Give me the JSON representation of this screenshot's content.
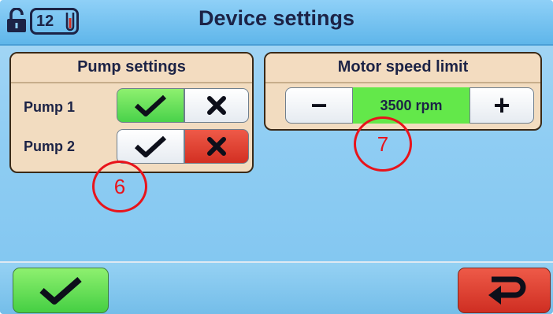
{
  "header": {
    "title": "Device settings",
    "user_level": "12",
    "lock_icon": "unlocked-padlock-icon",
    "tube_icon": "test-tube-icon"
  },
  "pump_settings": {
    "title": "Pump settings",
    "pumps": [
      {
        "label": "Pump 1",
        "enabled": true
      },
      {
        "label": "Pump 2",
        "enabled": false
      }
    ]
  },
  "motor_speed": {
    "title": "Motor speed limit",
    "value": "3500 rpm",
    "decrease_label": "−",
    "increase_label": "+"
  },
  "footer": {
    "confirm_icon": "checkmark-icon",
    "back_icon": "return-arrow-icon"
  },
  "annotations": {
    "callout_pump": "6",
    "callout_speed": "7"
  },
  "colors": {
    "active_green": "#49d24a",
    "inactive_red": "#d32f22",
    "callout_red": "#e8141b",
    "text_dark": "#1c2346"
  }
}
